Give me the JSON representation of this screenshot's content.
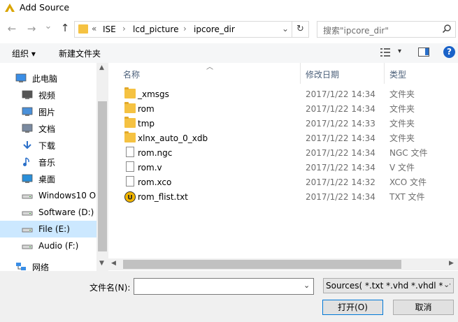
{
  "window": {
    "title": "Add Source"
  },
  "nav": {
    "back": "←",
    "forward": "→",
    "dropdown": "⌄",
    "up": "↑",
    "breadcrumb": [
      "ISE",
      "lcd_picture",
      "ipcore_dir"
    ],
    "overflow": "«",
    "search_placeholder": "搜索\"ipcore_dir\""
  },
  "toolbar": {
    "organize": "组织 ▾",
    "new_folder": "新建文件夹"
  },
  "sidebar": {
    "items": [
      {
        "label": "此电脑",
        "icon": "computer-icon"
      },
      {
        "label": "视频",
        "icon": "video-icon"
      },
      {
        "label": "图片",
        "icon": "picture-icon"
      },
      {
        "label": "文档",
        "icon": "document-icon"
      },
      {
        "label": "下载",
        "icon": "download-icon"
      },
      {
        "label": "音乐",
        "icon": "music-icon"
      },
      {
        "label": "桌面",
        "icon": "desktop-icon"
      },
      {
        "label": "Windows10 OS",
        "icon": "drive-windows-icon"
      },
      {
        "label": "Software (D:)",
        "icon": "drive-icon"
      },
      {
        "label": "File (E:)",
        "icon": "drive-icon",
        "selected": true
      },
      {
        "label": "Audio (F:)",
        "icon": "drive-icon"
      },
      {
        "label": "网络",
        "icon": "network-icon"
      }
    ]
  },
  "columns": {
    "name": "名称",
    "date": "修改日期",
    "type": "类型"
  },
  "files": [
    {
      "name": "_xmsgs",
      "date": "2017/1/22 14:34",
      "type": "文件夹",
      "kind": "folder"
    },
    {
      "name": "rom",
      "date": "2017/1/22 14:34",
      "type": "文件夹",
      "kind": "folder"
    },
    {
      "name": "tmp",
      "date": "2017/1/22 14:33",
      "type": "文件夹",
      "kind": "folder"
    },
    {
      "name": "xlnx_auto_0_xdb",
      "date": "2017/1/22 14:34",
      "type": "文件夹",
      "kind": "folder"
    },
    {
      "name": "rom.ngc",
      "date": "2017/1/22 14:34",
      "type": "NGC 文件",
      "kind": "doc"
    },
    {
      "name": "rom.v",
      "date": "2017/1/22 14:34",
      "type": "V 文件",
      "kind": "doc"
    },
    {
      "name": "rom.xco",
      "date": "2017/1/22 14:32",
      "type": "XCO 文件",
      "kind": "doc"
    },
    {
      "name": "rom_flist.txt",
      "date": "2017/1/22 14:34",
      "type": "TXT 文件",
      "kind": "ue"
    }
  ],
  "footer": {
    "filename_label": "文件名(N):",
    "filename_value": "",
    "filter": "Sources( *.txt *.vhd *.vhdl *.v",
    "open": "打开(O)",
    "cancel": "取消"
  },
  "colors": {
    "selected_bg": "#cce8ff",
    "accent": "#0066cc",
    "folder": "#f5c242"
  }
}
